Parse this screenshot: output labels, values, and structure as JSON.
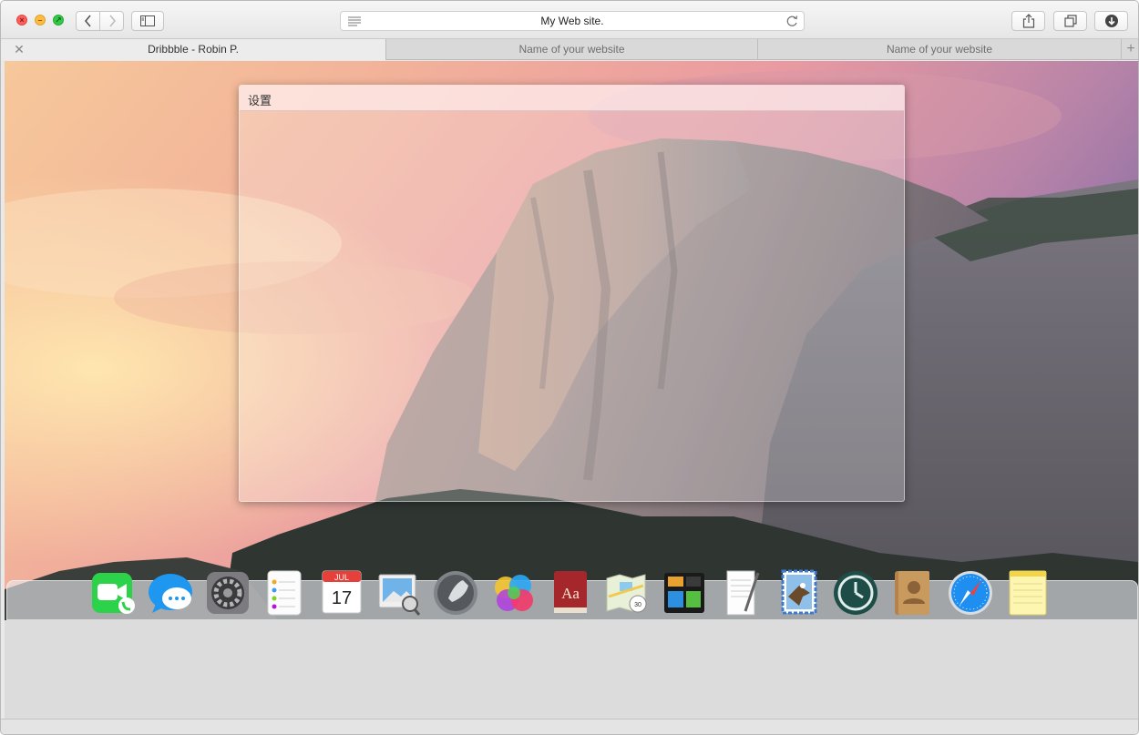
{
  "browser": {
    "address_text": "My Web site.",
    "tabs": [
      {
        "label": "Dribbble  -  Robin P.",
        "active": true
      },
      {
        "label": "Name of your website",
        "active": false
      },
      {
        "label": "Name of your website",
        "active": false
      }
    ],
    "icons": {
      "back": "chevron-left-icon",
      "forward": "chevron-right-icon",
      "sidebar": "sidebar-icon",
      "reader": "reader-icon",
      "reload": "reload-icon",
      "share": "share-icon",
      "tabs_overview": "tabs-overview-icon",
      "downloads": "download-icon",
      "close_tab": "close-icon",
      "new_tab": "plus-icon"
    },
    "colors": {
      "close": "#fc605c",
      "minimize": "#fdbc40",
      "zoom": "#34c84a"
    }
  },
  "settings_panel": {
    "title": "设置"
  },
  "dock": {
    "items": [
      {
        "name": "FaceTime",
        "icon": "facetime-icon"
      },
      {
        "name": "Messages",
        "icon": "messages-icon"
      },
      {
        "name": "System Preferences",
        "icon": "system-preferences-icon"
      },
      {
        "name": "Reminders",
        "icon": "reminders-icon"
      },
      {
        "name": "Calendar",
        "icon": "calendar-icon",
        "month": "JUL",
        "day": "17"
      },
      {
        "name": "Preview",
        "icon": "preview-icon"
      },
      {
        "name": "Launchpad",
        "icon": "launchpad-icon"
      },
      {
        "name": "Game Center",
        "icon": "game-center-icon"
      },
      {
        "name": "Dictionary",
        "icon": "dictionary-icon",
        "glyph": "Aa"
      },
      {
        "name": "Maps",
        "icon": "maps-icon"
      },
      {
        "name": "Mission Control",
        "icon": "mission-control-icon"
      },
      {
        "name": "TextEdit",
        "icon": "textedit-icon"
      },
      {
        "name": "Mail",
        "icon": "mail-icon"
      },
      {
        "name": "Time Machine",
        "icon": "time-machine-icon"
      },
      {
        "name": "Contacts",
        "icon": "contacts-icon"
      },
      {
        "name": "Safari",
        "icon": "safari-icon"
      },
      {
        "name": "Notes",
        "icon": "notes-icon"
      }
    ]
  }
}
